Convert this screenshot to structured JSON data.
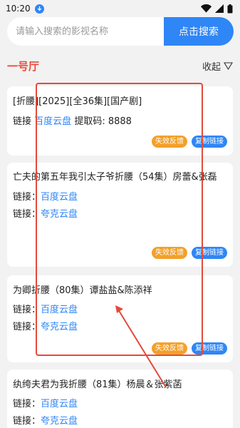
{
  "status": {
    "time": "10:20"
  },
  "search": {
    "placeholder": "请输入搜索的影视名称",
    "button": "点击搜索"
  },
  "section": {
    "title": "一号厅",
    "collapse": "收起"
  },
  "link_label": "链接",
  "link_label_colon": "链接：",
  "quark": "夸克云盘",
  "baidu": "百度云盘",
  "feedback": "失效反馈",
  "copy": "复制链接",
  "cards": [
    {
      "title": "[折腰][2025][全36集][国产剧]",
      "code": "提取码: 8888"
    },
    {
      "title": "亡夫的第五年我引太子爷折腰（54集）房蕾&张磊"
    },
    {
      "title": "为卿折腰（80集）谭盐盐&陈添祥"
    },
    {
      "title": "纨绔夫君为我折腰（81集）杨晨＆张紫菡"
    }
  ],
  "colors": {
    "accent": "#2f86f6",
    "section_title": "#e84b3a",
    "feedback": "#f3a02a",
    "annotation": "#e34a3a"
  }
}
